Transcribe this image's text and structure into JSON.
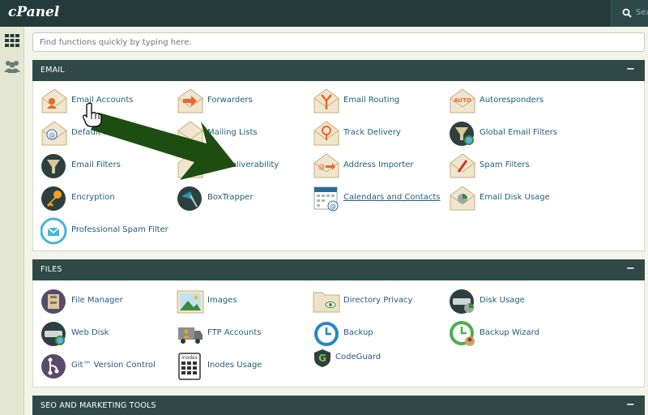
{
  "header": {
    "logo": "cPanel",
    "search_placeholder": "Sear"
  },
  "sidebar": {
    "items": [
      {
        "icon": "grid-icon"
      },
      {
        "icon": "users-icon"
      }
    ]
  },
  "quick_search": {
    "placeholder": "Find functions quickly by typing here."
  },
  "sections": {
    "email": {
      "title": "EMAIL",
      "items": [
        {
          "label": "Email Accounts",
          "icon": "email-accounts-icon"
        },
        {
          "label": "Forwarders",
          "icon": "forwarders-icon"
        },
        {
          "label": "Email Routing",
          "icon": "email-routing-icon"
        },
        {
          "label": "Autoresponders",
          "icon": "autoresponders-icon",
          "icon_text": "AUTO"
        },
        {
          "label": "Default Address",
          "icon": "default-address-icon"
        },
        {
          "label": "Mailing Lists",
          "icon": "mailing-lists-icon"
        },
        {
          "label": "Track Delivery",
          "icon": "track-delivery-icon"
        },
        {
          "label": "Global Email Filters",
          "icon": "global-email-filters-icon"
        },
        {
          "label": "Email Filters",
          "icon": "email-filters-icon"
        },
        {
          "label": "Deliverability",
          "icon": "email-deliverability-icon"
        },
        {
          "label": "Address Importer",
          "icon": "address-importer-icon"
        },
        {
          "label": "Spam Filters",
          "icon": "spam-filters-icon"
        },
        {
          "label": "Encryption",
          "icon": "encryption-icon"
        },
        {
          "label": "BoxTrapper",
          "icon": "boxtrapper-icon"
        },
        {
          "label": "Calendars and Contacts",
          "icon": "calendars-contacts-icon"
        },
        {
          "label": "Email Disk Usage",
          "icon": "email-disk-usage-icon"
        },
        {
          "label": "Professional Spam Filter",
          "icon": "professional-spam-filter-icon"
        }
      ]
    },
    "files": {
      "title": "FILES",
      "items": [
        {
          "label": "File Manager",
          "icon": "file-manager-icon"
        },
        {
          "label": "Images",
          "icon": "images-icon"
        },
        {
          "label": "Directory Privacy",
          "icon": "directory-privacy-icon"
        },
        {
          "label": "Disk Usage",
          "icon": "disk-usage-icon"
        },
        {
          "label": "Web Disk",
          "icon": "web-disk-icon"
        },
        {
          "label": "FTP Accounts",
          "icon": "ftp-accounts-icon"
        },
        {
          "label": "Backup",
          "icon": "backup-icon"
        },
        {
          "label": "Backup Wizard",
          "icon": "backup-wizard-icon"
        },
        {
          "label": "Git™ Version Control",
          "icon": "git-icon"
        },
        {
          "label": "Inodes Usage",
          "icon": "inodes-usage-icon",
          "icon_text": "inodes"
        },
        {
          "label": "CodeGuard",
          "icon": "codeguard-icon"
        }
      ]
    },
    "seo": {
      "title": "SEO AND MARKETING TOOLS"
    }
  },
  "colors": {
    "topbar": "#233b3b",
    "panel_header": "#2f4947",
    "link": "#1f5c80",
    "arrow": "#1e4d12",
    "envelope": "#f0e6cf",
    "accent_orange": "#e8672a"
  }
}
